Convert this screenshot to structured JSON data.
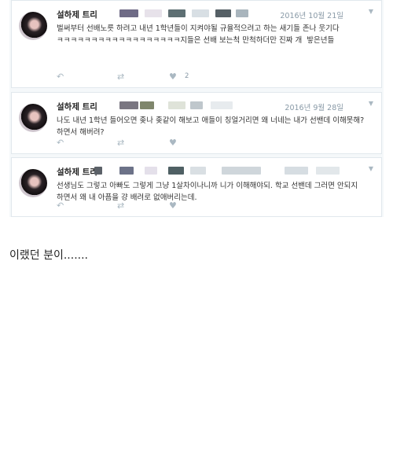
{
  "tweets": [
    {
      "name": "설하제 트리",
      "date": "2016년 10월 21일",
      "text": "벌써부터 선배노릇 하려고 내년 1학년들이 지켜야될 규율적으려고 하는 새기들 존나 웃기다 ㅋㅋㅋㅋㅋㅋㅋㅋㅋㅋㅋㅋㅋㅋㅋㅋㅋㅋ지들은 선배 보는척 만척하더만 진짜 개  밯은년들",
      "like_count": "2"
    },
    {
      "name": "설하제 트리",
      "date": "2016년 9월 28일",
      "text": "나도 내년 1학년 들어오면 좆나 좆같이 해보고 애들이 칭얼거리면 왜 너네는 내가 선밴데 이해못해? 하면서 해버려?",
      "like_count": ""
    },
    {
      "name": "설하제 트리",
      "date": "",
      "text": "선생님도 그렇고 아빠도 그렇게 그냥 1살차이나니까 니가 이해해야되. 학교 선밴데 그러면 안되지 하면서 왜 내 아픔을 걍 배려로 없애버리는데.",
      "like_count": ""
    }
  ],
  "icons": {
    "reply": "reply-icon",
    "retweet": "retweet-icon",
    "like": "heart-icon",
    "more": "chevron-down-icon"
  },
  "caption": "이랬던 분이......."
}
